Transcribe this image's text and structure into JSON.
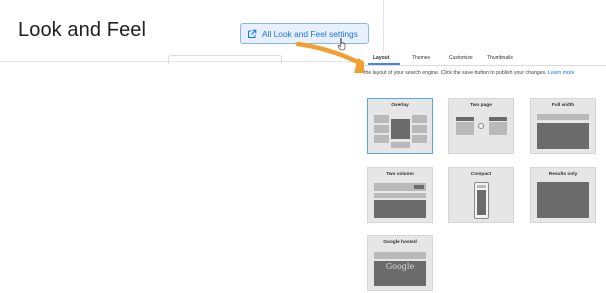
{
  "card": {
    "title": "Look and Feel",
    "settings_button": "All Look and Feel settings"
  },
  "panel": {
    "tabs": [
      {
        "label": "Layout",
        "active": true
      },
      {
        "label": "Themes",
        "active": false
      },
      {
        "label": "Customize",
        "active": false
      },
      {
        "label": "Thumbnails",
        "active": false
      }
    ],
    "hint": "the layout of your search engine. Click the save button to publish your changes.",
    "hint_link": "Learn more",
    "layouts": [
      {
        "label": "Overlay",
        "selected": true
      },
      {
        "label": "Two page",
        "selected": false
      },
      {
        "label": "Full width",
        "selected": false
      },
      {
        "label": "Two column",
        "selected": false
      },
      {
        "label": "Compact",
        "selected": false
      },
      {
        "label": "Results only",
        "selected": false
      },
      {
        "label": "Google hosted",
        "selected": false
      }
    ],
    "google_word": "Google"
  },
  "colors": {
    "accent": "#1a73e8",
    "arrow": "#f0a033",
    "selected_border": "#5aa7e6"
  }
}
